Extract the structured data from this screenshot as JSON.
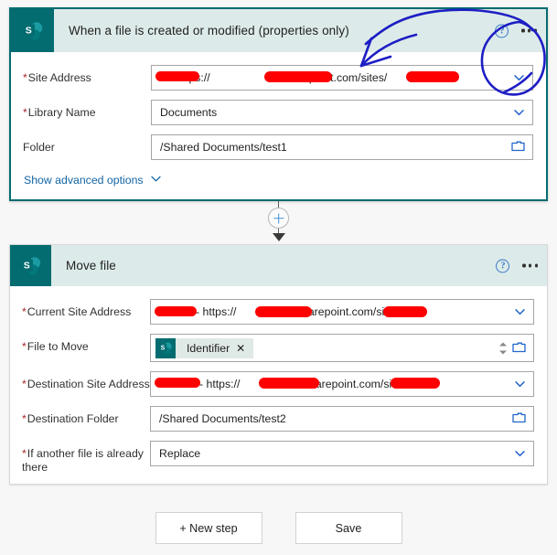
{
  "app": {
    "background_color": "#f7f7f7",
    "accent_teal": "#036C70",
    "header_band_color": "#dcebe9",
    "link_color": "#1264a3",
    "required_color": "#a4262c",
    "redaction_color": "#fe0000",
    "annotation_ink_color": "#1d1ec4"
  },
  "trigger_card": {
    "title": "When a file is created or modified (properties only)",
    "icon": "sharepoint-icon",
    "help_icon": "help-circle-icon",
    "menu_icon": "ellipsis-icon",
    "selected": true,
    "fields": [
      {
        "label": "Site Address",
        "required": true,
        "value": "— https://—.sharepoint.com/sites/—",
        "value_prefix": "1 - https://",
        "value_mid": ".sharepoint.com/sites/",
        "control": "dropdown",
        "redacted": true
      },
      {
        "label": "Library Name",
        "required": true,
        "value": "Documents",
        "control": "dropdown",
        "redacted": false
      },
      {
        "label": "Folder",
        "required": false,
        "value": "/Shared Documents/test1",
        "control": "folder-picker",
        "redacted": false
      }
    ],
    "advanced_options_label": "Show advanced options",
    "advanced_options_icon": "chevron-down-icon"
  },
  "connector": {
    "add_step_icon": "plus-circle-icon",
    "arrow_icon": "arrow-down-icon"
  },
  "action_card": {
    "title": "Move file",
    "icon": "sharepoint-icon",
    "help_icon": "help-circle-icon",
    "menu_icon": "ellipsis-icon",
    "selected": false,
    "fields": [
      {
        "label": "Current Site Address",
        "required": true,
        "value_prefix": " - https://",
        "value_mid": ".sharepoint.com/sites/",
        "control": "dropdown",
        "redacted": true
      },
      {
        "label": "File to Move",
        "required": true,
        "token": {
          "icon": "sharepoint-icon",
          "label": "Identifier",
          "remove_icon": "close-x-icon"
        },
        "control": "token-picker",
        "redacted": false
      },
      {
        "label": "Destination Site Address",
        "required": true,
        "value_prefix": " - https://",
        "value_mid": ".sharepoint.com/sites/",
        "control": "dropdown",
        "redacted": true
      },
      {
        "label": "Destination Folder",
        "required": true,
        "value": "/Shared Documents/test2",
        "control": "folder-picker",
        "redacted": false
      },
      {
        "label": "If another file is already there",
        "required": true,
        "value": "Replace",
        "control": "dropdown",
        "redacted": false
      }
    ]
  },
  "footer": {
    "new_step_label": "+ New step",
    "save_label": "Save"
  }
}
